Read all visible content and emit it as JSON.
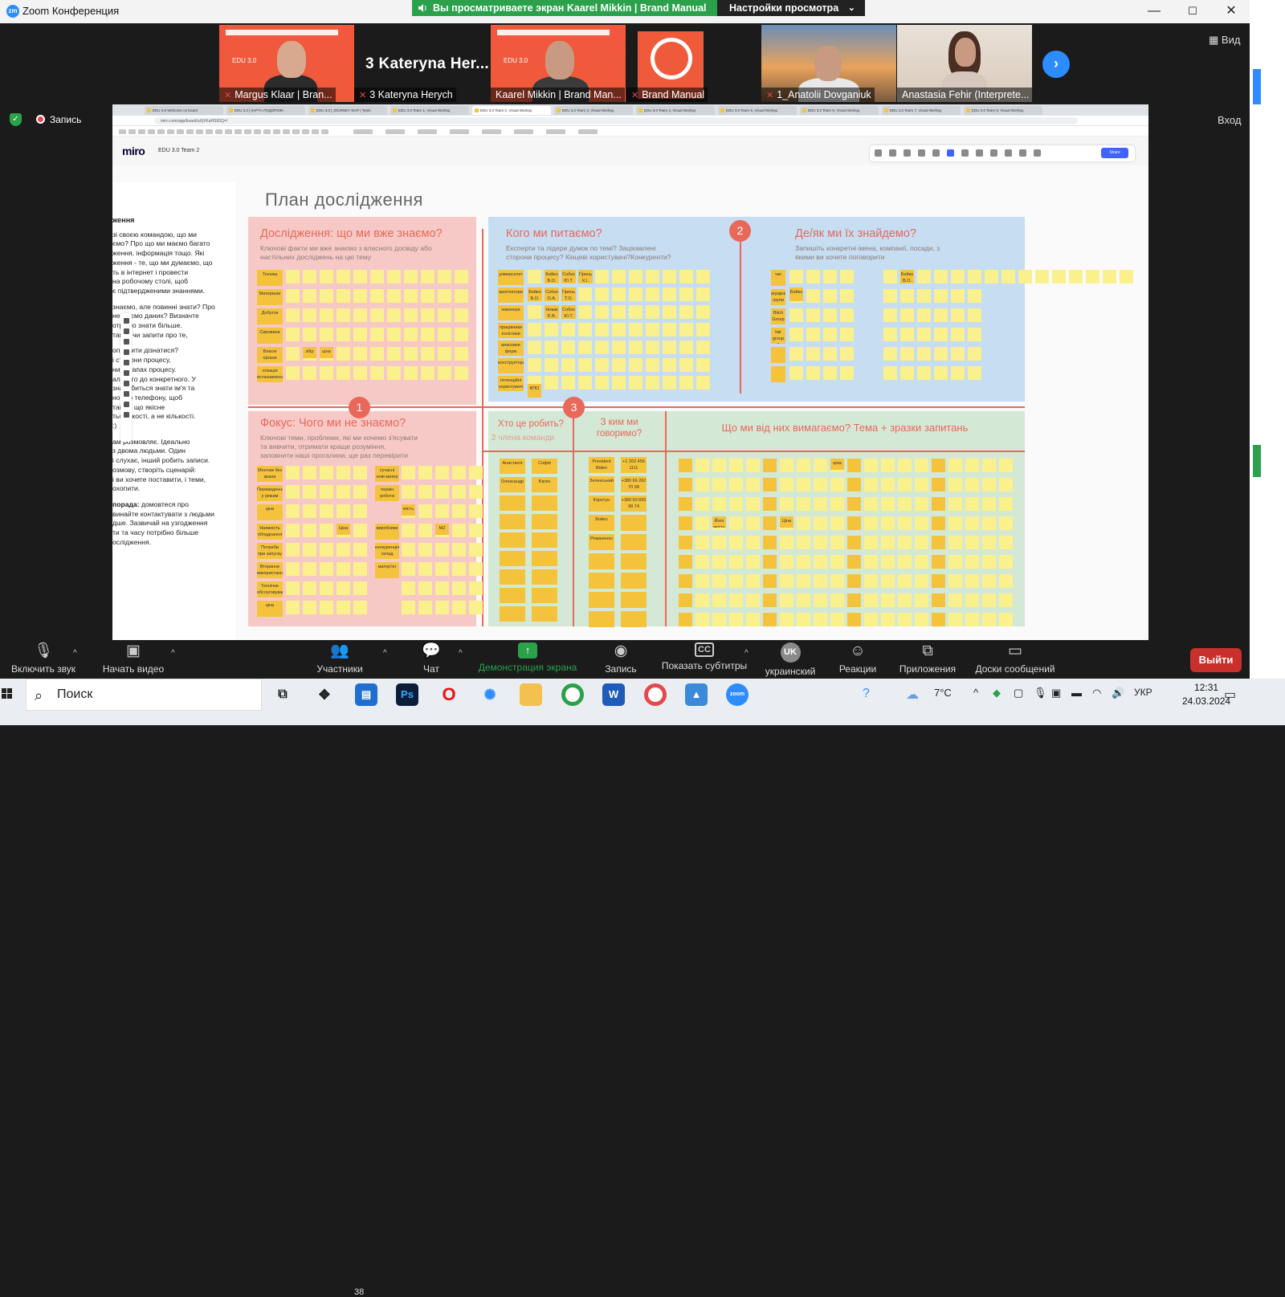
{
  "window": {
    "title": "Zoom Конференция",
    "logo_text": "zm",
    "minimize": "—",
    "maximize": "☐",
    "close": "✕"
  },
  "share_banner": {
    "text": "Вы просматриваете экран Kaarel Mikkin | Brand Manual",
    "view_settings": "Настройки просмотра",
    "chev": "⌄"
  },
  "gallery": {
    "tiles": [
      {
        "name": "Margus Klaar | Bran..."
      },
      {
        "name": "3 Kateryna Herych",
        "display": "3  Kateryna Her..."
      },
      {
        "name": "Kaarel Mikkin | Brand Man..."
      },
      {
        "name": "Brand Manual"
      },
      {
        "name": "1_Anatolii Dovganiuk"
      },
      {
        "name": "Anastasia Fehir (Interprete..."
      }
    ],
    "poster_edu": "EDU 3.0",
    "next": "›",
    "view_label": "Вид"
  },
  "status": {
    "recording": "Запись",
    "login": "Вход"
  },
  "browser": {
    "tabs": [
      "EDU 3.0 Welcome on board",
      "EDU 3.0 | КАРТА ПОДОРОЖІ",
      "EDU 3.0 | JOURNEY MAP | Team",
      "EDU 3.0 Team 1, Visual Worksp.",
      "EDU 3.0 Team 2, Visual Worksp.",
      "EDU 3.0 Team 3, Visual Worksp.",
      "EDU 3.0 Team 4, Visual Worksp.",
      "EDU 3.0 Team 5, Visual Worksp.",
      "EDU 3.0 Team 6, Visual Worksp.",
      "EDU 3.0 Team 7, Visual Worksp.",
      "EDU 3.0 Team 8, Visual Worksp."
    ],
    "url": "miro.com/app/board/uXjVKaHS92Q=/"
  },
  "miro": {
    "logo": "miro",
    "board_name": "EDU 3.0 Team 2",
    "share": "Share"
  },
  "left_panel": {
    "heading": "ження",
    "p1": "зі своєю командою, що ми\nємо? Про що ми маємо багато\nження, інформація тощо. Які\nження - те, що ми думаємо, що\nть в інтернет і провести\nна робочому столі, щоб\nє підтвердженими знаннями.",
    "p2": "знаємо, але повинні знати? Про\nне маємо даних? Визначте\nотрібно знати більше.\nтання чи запити про те,",
    "p3": "опросити дізнатися?\nі сторони процесу,\nних етапах процесу.\nального до конкретного. У\nзнадобиться знати ім'я та\nномер телефону, щоб\nтайте, що якісне\nться якості, а не кількості.\n:)",
    "p4": "ам розмовляє. Ідеально\n з двома людьми. Один\nі слухає, інший робить записи.\nозмову, створіть сценарій:\nі ви хочете поставити, і теми,\nохопити.",
    "p5_bold": "порада:",
    "p5": " домовтеся про\nвинайте контактувати з людьми\nдше. Зазвичай на узгодження\nти та часу потрібно більше\nослідження."
  },
  "board": {
    "title": "План дослідження",
    "z1": {
      "title": "Дослідження: що ми вже знаємо?",
      "sub": "Ключові факти ми вже знаємо з власного досвіду або\nнастільних досліджень на цю тему",
      "rows": [
        "Техніка",
        "Матеріали",
        "Добуток",
        "Сировина",
        "Власні органи керування",
        "локація встановлення"
      ],
      "words": [
        "збір",
        "ціна"
      ]
    },
    "z2": {
      "title": "Кого ми питаємо?",
      "sub": "Експерти та лідери думок по темі? Зацікавлені\nсторони процесу? Кінцеві користувачі?Конкуренти?",
      "rows": [
        "університет",
        "архітектори",
        "інженери",
        "працівники логістики",
        "власники ферм",
        "конструктори",
        "потенційні користувачі"
      ],
      "r1": [
        "Бойко В.О.",
        "Собко Ю.Т.",
        "Гірень К.І."
      ],
      "r2": [
        "Бойко В.О.",
        "Собко О.А.",
        "Гірень Т.О."
      ],
      "r3": [
        "Новак Є.В.",
        "Собко Ю.Т."
      ],
      "vpo": "ВПО"
    },
    "z3": {
      "title": "Де/як ми їх знайдемо?",
      "sub": "Запишіть конкретні імена, компанії, посади, з\nякими ви хочете поговорити",
      "rows": [
        "чат",
        "аграрні групи",
        "Bitch Group",
        "fair group & network"
      ],
      "r1": "Бойко",
      "r2": "Бойко В.О."
    },
    "z4": {
      "title": "Фокус: Чого ми не знаємо?",
      "sub": "Ключові теми, проблеми, які ми хочемо з'ясувати\nта вивчити, отримати краще розуміння,\nзаповнити наші прогалини, ще раз перевірити",
      "rows": [
        "Монтаж без крана",
        "Переведення у режим запасу",
        "ціна",
        "Наявність обладнання",
        "Потреби при запуску",
        "Вторинне використання",
        "Технічне обслуговування",
        "ціна"
      ],
      "col2": [
        "сучасні нові матер",
        "термін роботи",
        "виробники",
        "конкуренція склад",
        "матер'ял"
      ],
      "words": [
        "Ціна",
        "мість",
        "М2"
      ]
    },
    "z5": {
      "title": "Хто це робить?",
      "sub": "2 члена команди",
      "names": [
        "Анастасія",
        "Олександр",
        "Софія",
        "Євген"
      ]
    },
    "z6": {
      "title": "З ким ми говоримо?",
      "names": [
        "President Biden",
        "Зеленський",
        "Коротун",
        "Бойко",
        "Романенко"
      ],
      "phones": [
        "+1 202 456 1111",
        "+380 66 262 70 98",
        "+380 50 820 98 74"
      ]
    },
    "z7": {
      "title": "Що ми від них вимагаємо? Тема + зразки запитань",
      "words": [
        "ціна",
        "Ціна",
        "Його якість"
      ]
    },
    "badges": [
      "1",
      "2",
      "3"
    ]
  },
  "toolbar": {
    "mute": "Включить звук",
    "video": "Начать видео",
    "participants": "Участники",
    "participants_count": "38",
    "chat": "Чат",
    "share": "Демонстрация экрана",
    "record": "Запись",
    "captions": "Показать субтитры",
    "language": "украинский",
    "lang_code": "UK",
    "reactions": "Реакции",
    "apps": "Приложения",
    "whiteboards": "Доски сообщений",
    "leave": "Выйти",
    "caret": "^"
  },
  "taskbar": {
    "search": "Поиск",
    "weather": "7°C",
    "lang": "УКР",
    "time": "12:31",
    "date": "24.03.2024"
  },
  "colors": {
    "zoom_blue": "#2d8cff",
    "share_green": "#2aa14a",
    "leave_red": "#c9302c",
    "miro_pink": "#f7c9c6",
    "miro_blue": "#c6ddf2",
    "miro_green": "#d4e8d6",
    "sticky": "#faf08c",
    "accent": "#e8685a"
  }
}
